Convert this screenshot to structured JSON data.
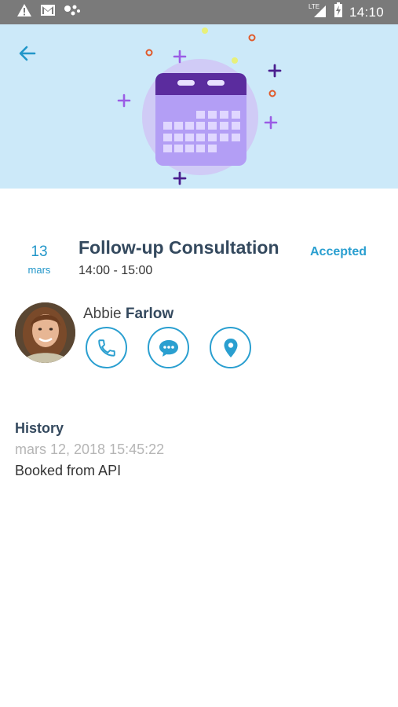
{
  "status_bar": {
    "time": "14:10",
    "network": "LTE",
    "icons": [
      "alert-icon",
      "gmail-icon",
      "assistant-dots-icon",
      "signal-icon",
      "battery-charging-icon"
    ]
  },
  "header": {
    "back_icon": "arrow-left-icon",
    "illustration": "calendar-illustration"
  },
  "appointment": {
    "day": "13",
    "month": "mars",
    "title": "Follow-up Consultation",
    "time": "14:00 - 15:00",
    "status": "Accepted"
  },
  "contact": {
    "first_name": "Abbie",
    "last_name": "Farlow",
    "actions": [
      {
        "name": "call-button",
        "icon": "phone-icon"
      },
      {
        "name": "message-button",
        "icon": "chat-icon"
      },
      {
        "name": "location-button",
        "icon": "location-pin-icon"
      }
    ]
  },
  "history": {
    "title": "History",
    "entries": [
      {
        "date": "mars 12, 2018 15:45:22",
        "description": "Booked from API"
      }
    ]
  },
  "colors": {
    "accent": "#2a9fd0",
    "header_bg": "#cce9f9",
    "title": "#34495e",
    "calendar_purple": "#5b2c9e",
    "calendar_body": "#b39ef5"
  }
}
